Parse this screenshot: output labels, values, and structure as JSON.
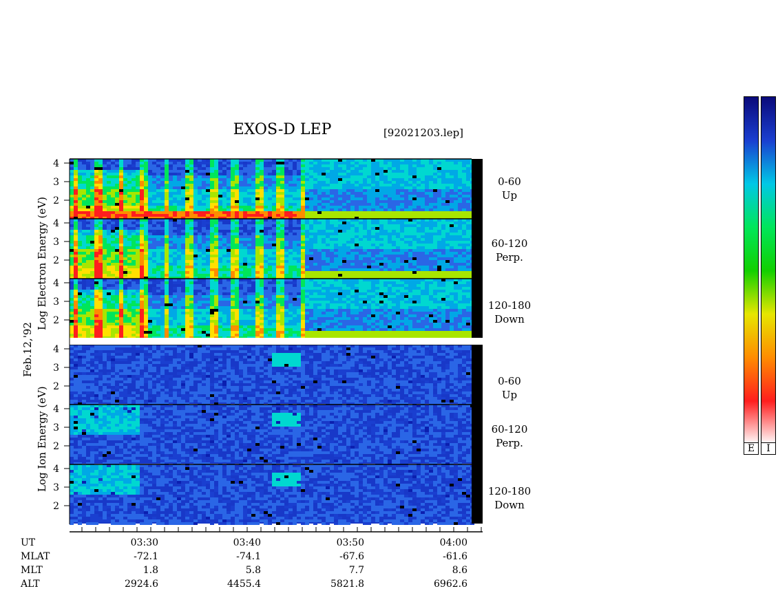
{
  "header": {
    "title": "EXOS-D LEP",
    "file": "[92021203.lep]"
  },
  "left_labels": {
    "electron_axis": "Log  Electron  Energy (eV)",
    "ion_axis": "Log  Ion  Energy (eV)",
    "date": "Feb.12,'92"
  },
  "panels": [
    {
      "species": "electron",
      "range": "0-60",
      "dir": "Up"
    },
    {
      "species": "electron",
      "range": "60-120",
      "dir": "Perp."
    },
    {
      "species": "electron",
      "range": "120-180",
      "dir": "Down"
    },
    {
      "species": "ion",
      "range": "0-60",
      "dir": "Up"
    },
    {
      "species": "ion",
      "range": "60-120",
      "dir": "Perp."
    },
    {
      "species": "ion",
      "range": "120-180",
      "dir": "Down"
    }
  ],
  "y_ticks": [
    "4",
    "3",
    "2"
  ],
  "time_axis": {
    "row_labels": {
      "ut": "UT",
      "mlat": "MLAT",
      "mlt": "MLT",
      "alt": "ALT"
    },
    "columns": [
      {
        "ut": "03:30",
        "mlat": "-72.1",
        "mlt": "1.8",
        "alt": "2924.6"
      },
      {
        "ut": "03:40",
        "mlat": "-74.1",
        "mlt": "5.8",
        "alt": "4455.4"
      },
      {
        "ut": "03:50",
        "mlat": "-67.6",
        "mlt": "7.7",
        "alt": "5821.8"
      },
      {
        "ut": "04:00",
        "mlat": "-61.6",
        "mlt": "8.6",
        "alt": "6962.6"
      }
    ]
  },
  "colorbar": {
    "labels": [
      "E",
      "I"
    ],
    "colors": [
      "#0a0a7a",
      "#1a3fd0",
      "#00c8e6",
      "#00e65a",
      "#12d000",
      "#e6e600",
      "#ff8c00",
      "#ff1e1e",
      "#ffffff"
    ]
  },
  "chart_data": {
    "type": "heatmap",
    "title": "EXOS-D LEP",
    "x_ticks": [
      "03:30",
      "03:40",
      "03:50",
      "04:00"
    ],
    "y_ticks": [
      "4",
      "3",
      "2"
    ],
    "panels": [
      "0-60 Up",
      "60-120 Perp.",
      "120-180 Down",
      "0-60 Up",
      "60-120 Perp.",
      "120-180 Down"
    ]
  }
}
